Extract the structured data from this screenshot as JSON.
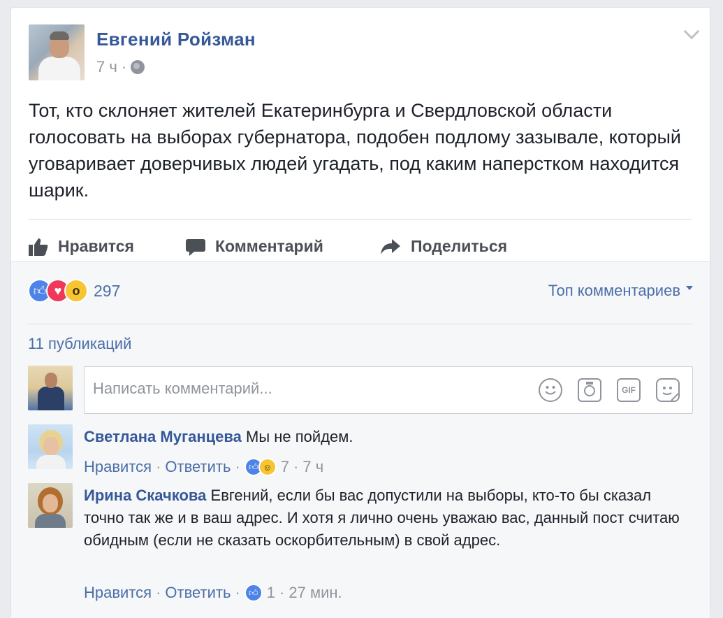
{
  "post": {
    "author": "Евгений Ройзман",
    "time": "7 ч",
    "time_sep": "·",
    "text": "Тот, кто склоняет жителей Екатеринбурга и Свердловской области голосовать на выборах губернатора, подобен подлому зазывале, который уговаривает доверчивых людей угадать, под каким наперстком находится шарик."
  },
  "actions": {
    "like": "Нравится",
    "comment": "Комментарий",
    "share": "Поделиться"
  },
  "reactions": {
    "count": "297",
    "icons": [
      "like-icon",
      "love-icon",
      "wow-icon"
    ]
  },
  "sort": {
    "label": "Топ комментариев"
  },
  "shares": {
    "label": "11 публикаций"
  },
  "composer": {
    "placeholder": "Написать комментарий...",
    "gif_label": "GIF"
  },
  "comments": [
    {
      "name": "Светлана Муганцева",
      "text": "Мы не пойдем.",
      "like_label": "Нравится",
      "reply_label": "Ответить",
      "reaction_count": "7",
      "time": "7 ч",
      "reaction_icons": [
        "like-icon",
        "haha-icon"
      ]
    },
    {
      "name": "Ирина Скачкова",
      "text": "Евгений, если бы вас допустили на выборы, кто-то бы сказал точно так же и в ваш адрес. И хотя я лично очень уважаю вас, данный пост считаю обидным (если не сказать оскорбительным) в свой адрес.",
      "like_label": "Нравится",
      "reply_label": "Ответить",
      "reaction_count": "1",
      "time": "27 мин.",
      "reaction_icons": [
        "like-icon"
      ]
    }
  ],
  "colors": {
    "link": "#365899",
    "secondary_link": "#4b6ea8",
    "meta": "#90949c",
    "text": "#1d2129",
    "like": "#4e83e8",
    "love": "#f0385b",
    "wow": "#f7c531"
  }
}
